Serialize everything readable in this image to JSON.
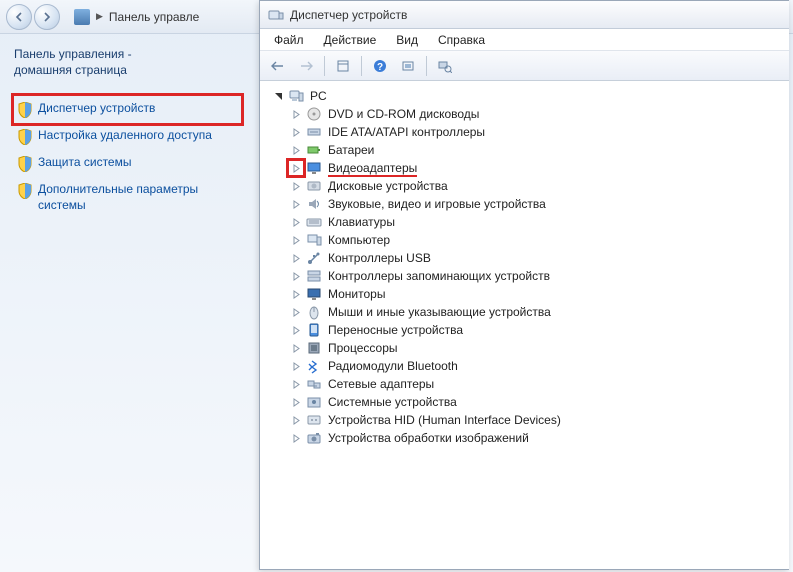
{
  "cp": {
    "breadcrumb_sep": "▶",
    "breadcrumb_text": "Панель управле",
    "home_title": "Панель управления -\nдомашняя страница",
    "links": [
      {
        "label": "Диспетчер устройств",
        "highlighted": true
      },
      {
        "label": "Настройка удаленного доступа",
        "highlighted": false
      },
      {
        "label": "Защита системы",
        "highlighted": false
      },
      {
        "label": "Дополнительные параметры системы",
        "highlighted": false
      }
    ]
  },
  "dm": {
    "title": "Диспетчер устройств",
    "menu": [
      "Файл",
      "Действие",
      "Вид",
      "Справка"
    ],
    "root": "PC",
    "nodes": [
      {
        "label": "DVD и CD-ROM дисководы",
        "icon": "disc"
      },
      {
        "label": "IDE ATA/ATAPI контроллеры",
        "icon": "ide"
      },
      {
        "label": "Батареи",
        "icon": "battery"
      },
      {
        "label": "Видеоадаптеры",
        "icon": "display",
        "highlighted": true
      },
      {
        "label": "Дисковые устройства",
        "icon": "hdd"
      },
      {
        "label": "Звуковые, видео и игровые устройства",
        "icon": "sound"
      },
      {
        "label": "Клавиатуры",
        "icon": "keyboard"
      },
      {
        "label": "Компьютер",
        "icon": "computer"
      },
      {
        "label": "Контроллеры USB",
        "icon": "usb"
      },
      {
        "label": "Контроллеры запоминающих устройств",
        "icon": "storage"
      },
      {
        "label": "Мониторы",
        "icon": "monitor"
      },
      {
        "label": "Мыши и иные указывающие устройства",
        "icon": "mouse"
      },
      {
        "label": "Переносные устройства",
        "icon": "portable"
      },
      {
        "label": "Процессоры",
        "icon": "cpu"
      },
      {
        "label": "Радиомодули Bluetooth",
        "icon": "bluetooth"
      },
      {
        "label": "Сетевые адаптеры",
        "icon": "network"
      },
      {
        "label": "Системные устройства",
        "icon": "system"
      },
      {
        "label": "Устройства HID (Human Interface Devices)",
        "icon": "hid"
      },
      {
        "label": "Устройства обработки изображений",
        "icon": "imaging"
      }
    ]
  }
}
